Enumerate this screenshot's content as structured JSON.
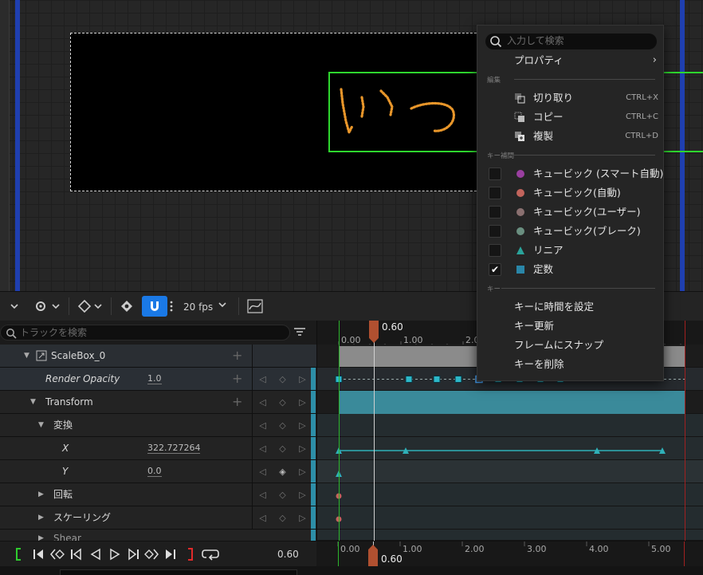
{
  "canvas": {
    "text": "いつ"
  },
  "toolbar": {
    "fps": "20 fps"
  },
  "tracks": {
    "search_placeholder": "トラックを検索",
    "rows": [
      {
        "label": "ScaleBox_0",
        "value": ""
      },
      {
        "label": "Render Opacity",
        "value": "1.0"
      },
      {
        "label": "Transform",
        "value": ""
      },
      {
        "label": "変換",
        "value": ""
      },
      {
        "label": "X",
        "value": "322.727264"
      },
      {
        "label": "Y",
        "value": "0.0"
      },
      {
        "label": "回転",
        "value": ""
      },
      {
        "label": "スケーリング",
        "value": ""
      },
      {
        "label": "Shear",
        "value": ""
      }
    ]
  },
  "timeline": {
    "playhead_time": "0.60",
    "ticks": [
      "0.00",
      "1.00",
      "2.00",
      "3.00",
      "4.00",
      "5.00"
    ]
  },
  "transport": {
    "time": "0.60"
  },
  "menu": {
    "search_placeholder": "入力して検索",
    "properties": "プロパティ",
    "section_edit": "編集",
    "cut": "切り取り",
    "cut_shortcut": "CTRL+X",
    "copy": "コピー",
    "copy_shortcut": "CTRL+C",
    "duplicate": "複製",
    "duplicate_shortcut": "CTRL+D",
    "section_interp": "キー補間",
    "interp": [
      {
        "label": "キュービック (スマート自動)",
        "color": "#9a3fa0",
        "checked": false
      },
      {
        "label": "キュービック(自動)",
        "color": "#c2645c",
        "checked": false
      },
      {
        "label": "キュービック(ユーザー)",
        "color": "#8a7070",
        "checked": false
      },
      {
        "label": "キュービック(ブレーク)",
        "color": "#6a8f80",
        "checked": false
      },
      {
        "label": "リニア",
        "color": "#2aa39a",
        "checked": false
      },
      {
        "label": "定数",
        "color": "#2a86a8",
        "checked": true
      }
    ],
    "section_key": "キー",
    "set_key_time": "キーに時間を設定",
    "rekey": "キー更新",
    "snap_to_frame": "フレームにスナップ",
    "delete_key": "キーを削除"
  }
}
